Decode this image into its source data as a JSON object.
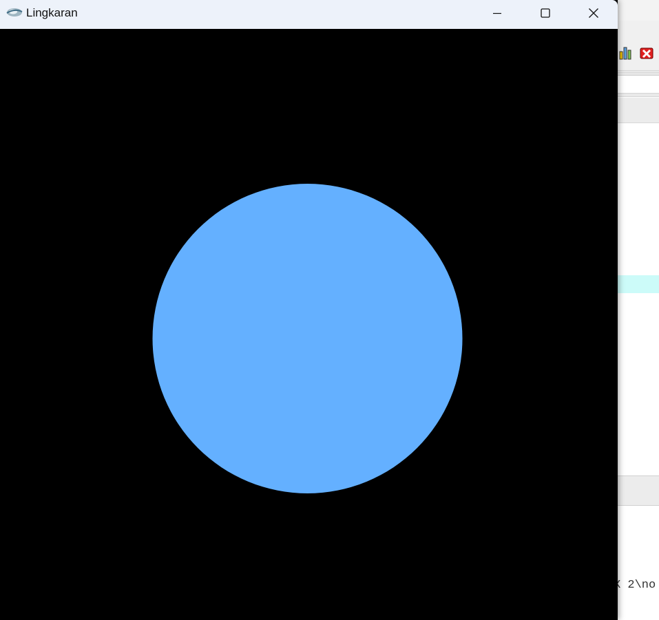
{
  "window": {
    "title": "Lingkaran",
    "controls": {
      "minimize": "minimize",
      "maximize": "maximize",
      "close": "close"
    }
  },
  "canvas": {
    "background": "#000000",
    "shape": "circle",
    "fill_color": "#64b0ff"
  },
  "background_app": {
    "output_text": "X 2\\no",
    "toolbar_icons": [
      "bar-chart-icon",
      "stop-build-icon"
    ],
    "highlight_color": "#ccfbf9"
  }
}
